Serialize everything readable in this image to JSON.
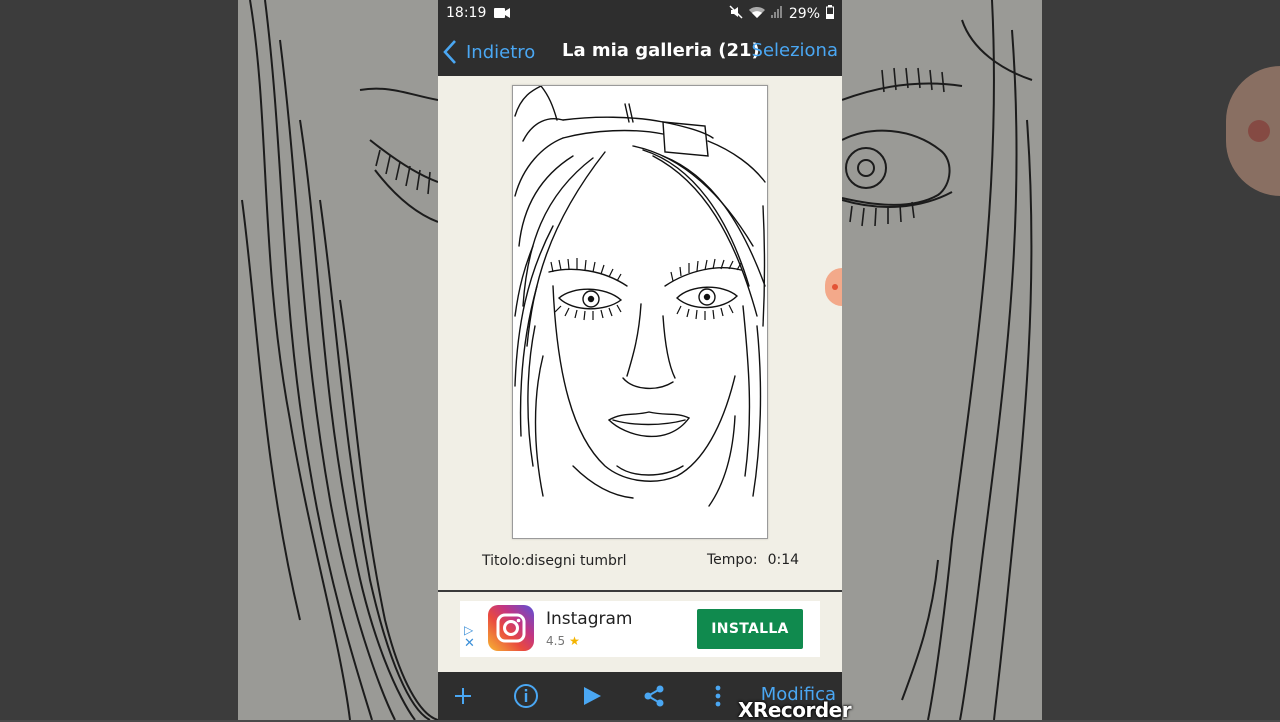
{
  "status_bar": {
    "time": "18:19",
    "battery": "29%"
  },
  "nav": {
    "back_label": "Indietro",
    "title": "La mia galleria (21)",
    "select_label": "Seleziona"
  },
  "drawing": {
    "title_label": "Titolo:",
    "title_value": "disegni tumbrl",
    "time_label": "Tempo:",
    "time_value": "0:14"
  },
  "ad": {
    "app_name": "Instagram",
    "rating": "4.5",
    "install_label": "INSTALLA"
  },
  "toolbar": {
    "edit_label": "Modifica"
  },
  "watermark": "XRecorder",
  "colors": {
    "accent": "#4aa7f3",
    "bar": "#2e2e2e",
    "install": "#108a4e",
    "paper": "#f1efe6"
  },
  "icons": [
    "chevron-left-icon",
    "video-record-icon",
    "mute-icon",
    "wifi-icon",
    "signal-icon",
    "battery-icon",
    "plus-icon",
    "info-icon",
    "play-icon",
    "share-icon",
    "more-icon",
    "ad-play-icon",
    "ad-close-icon",
    "star-icon",
    "instagram-logo"
  ]
}
